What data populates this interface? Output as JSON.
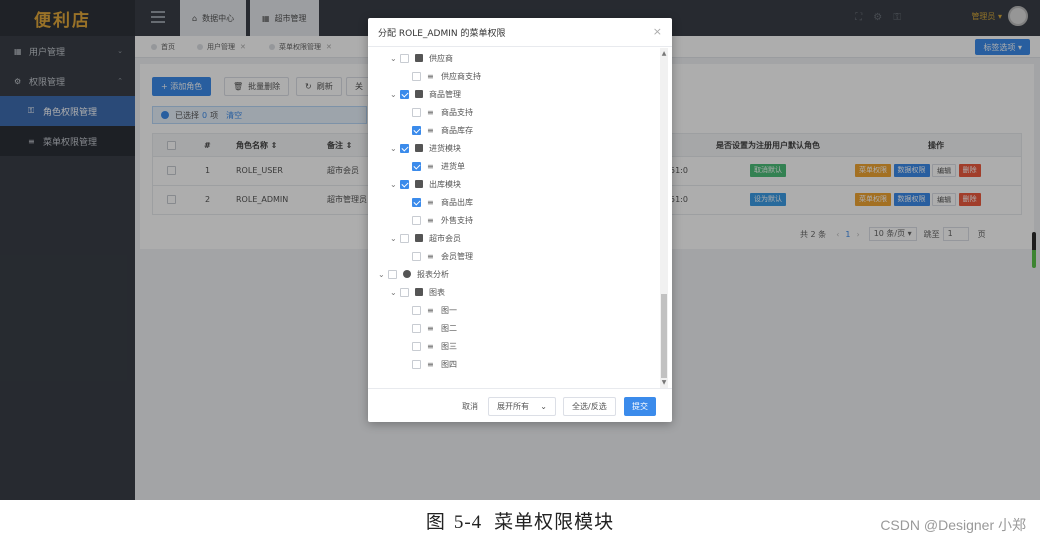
{
  "app": {
    "logo": "便利店",
    "user": "管理员 ▾"
  },
  "sidebar": {
    "items": [
      {
        "label": "用户管理"
      },
      {
        "label": "权限管理"
      },
      {
        "label": "角色权限管理"
      },
      {
        "label": "菜单权限管理"
      }
    ]
  },
  "topbar": {
    "tabs": [
      {
        "label": "数据中心"
      },
      {
        "label": "超市管理"
      }
    ]
  },
  "pagetabs": {
    "items": [
      {
        "label": "首页"
      },
      {
        "label": "用户管理"
      },
      {
        "label": "菜单权限管理"
      }
    ],
    "options_label": "标签选项 ▾"
  },
  "toolbar": {
    "add_label": "+ 添加角色",
    "batch_delete_label": "批量删除",
    "refresh_label": "刷新",
    "extra_label": "关"
  },
  "alert": {
    "prefix": "已选择",
    "count": "0",
    "suffix": "项",
    "clear": "清空"
  },
  "table": {
    "headers": [
      "#",
      "角色名称 ⇕",
      "备注 ⇕",
      "是否设置为注册用户默认角色",
      "操作"
    ],
    "rows": [
      {
        "index": "1",
        "name": "ROLE_USER",
        "remark": "超市会员",
        "time": "51:0",
        "default_action": "取消默认"
      },
      {
        "index": "2",
        "name": "ROLE_ADMIN",
        "remark": "超市管理员",
        "time": "51:0",
        "default_action": "设为默认"
      }
    ],
    "actions": {
      "menu": "菜单权限",
      "data": "数据权限",
      "edit": "编辑",
      "delete": "删除"
    }
  },
  "pager": {
    "total": "共 2 条",
    "prev": "‹",
    "page": "1",
    "next": "›",
    "size": "10 条/页 ▾",
    "goto": "跳至",
    "goto_value": "1",
    "unit": "页"
  },
  "modal": {
    "title": "分配 ROLE_ADMIN 的菜单权限",
    "close": "×",
    "tree": [
      {
        "label": "供应商"
      },
      {
        "label": "供应商支持"
      },
      {
        "label": "商品管理"
      },
      {
        "label": "商品支持"
      },
      {
        "label": "商品库存"
      },
      {
        "label": "进货模块"
      },
      {
        "label": "进货单"
      },
      {
        "label": "出库模块"
      },
      {
        "label": "商品出库"
      },
      {
        "label": "外售支持"
      },
      {
        "label": "超市会员"
      },
      {
        "label": "会员管理"
      },
      {
        "label": "报表分析"
      },
      {
        "label": "图表"
      },
      {
        "label": "图一"
      },
      {
        "label": "图二"
      },
      {
        "label": "图三"
      },
      {
        "label": "图四"
      }
    ],
    "footer": {
      "cancel": "取消",
      "expand_select": "展开所有",
      "select_all": "全选/反选",
      "submit": "提交"
    }
  },
  "caption": {
    "figure": "图",
    "number": "5-4",
    "text": "菜单权限模块"
  },
  "watermark": "CSDN @Designer 小郑",
  "colors": {
    "primary": "#3b8beb",
    "sidebar": "#3a3f47",
    "logo": "#e2a93b"
  }
}
